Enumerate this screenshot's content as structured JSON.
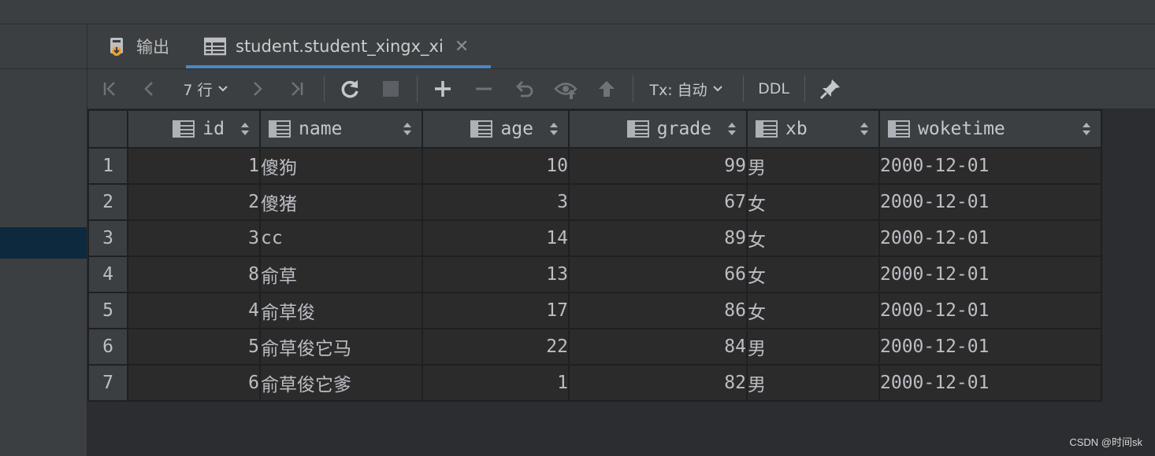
{
  "tabs": [
    {
      "label": "输出",
      "icon": "output-icon"
    },
    {
      "label": "student.student_xingx_xi",
      "icon": "table-icon",
      "active": true
    }
  ],
  "toolbar": {
    "rows_label": "7 行",
    "tx_label": "Tx: 自动",
    "ddl_label": "DDL"
  },
  "table": {
    "columns": [
      {
        "name": "id",
        "align": "right"
      },
      {
        "name": "name",
        "align": "left"
      },
      {
        "name": "age",
        "align": "right"
      },
      {
        "name": "grade",
        "align": "right"
      },
      {
        "name": "xb",
        "align": "left"
      },
      {
        "name": "woketime",
        "align": "left"
      }
    ],
    "rows": [
      {
        "n": "1",
        "id": "1",
        "name": "傻狗",
        "age": "10",
        "grade": "99",
        "xb": "男",
        "woketime": "2000-12-01"
      },
      {
        "n": "2",
        "id": "2",
        "name": "傻猪",
        "age": "3",
        "grade": "67",
        "xb": "女",
        "woketime": "2000-12-01"
      },
      {
        "n": "3",
        "id": "3",
        "name": "cc",
        "age": "14",
        "grade": "89",
        "xb": "女",
        "woketime": "2000-12-01"
      },
      {
        "n": "4",
        "id": "8",
        "name": "俞草",
        "age": "13",
        "grade": "66",
        "xb": "女",
        "woketime": "2000-12-01"
      },
      {
        "n": "5",
        "id": "4",
        "name": "俞草俊",
        "age": "17",
        "grade": "86",
        "xb": "女",
        "woketime": "2000-12-01"
      },
      {
        "n": "6",
        "id": "5",
        "name": "俞草俊它马",
        "age": "22",
        "grade": "84",
        "xb": "男",
        "woketime": "2000-12-01"
      },
      {
        "n": "7",
        "id": "6",
        "name": "俞草俊它爹",
        "age": "1",
        "grade": "82",
        "xb": "男",
        "woketime": "2000-12-01"
      }
    ]
  },
  "watermark": "CSDN @时间sk"
}
